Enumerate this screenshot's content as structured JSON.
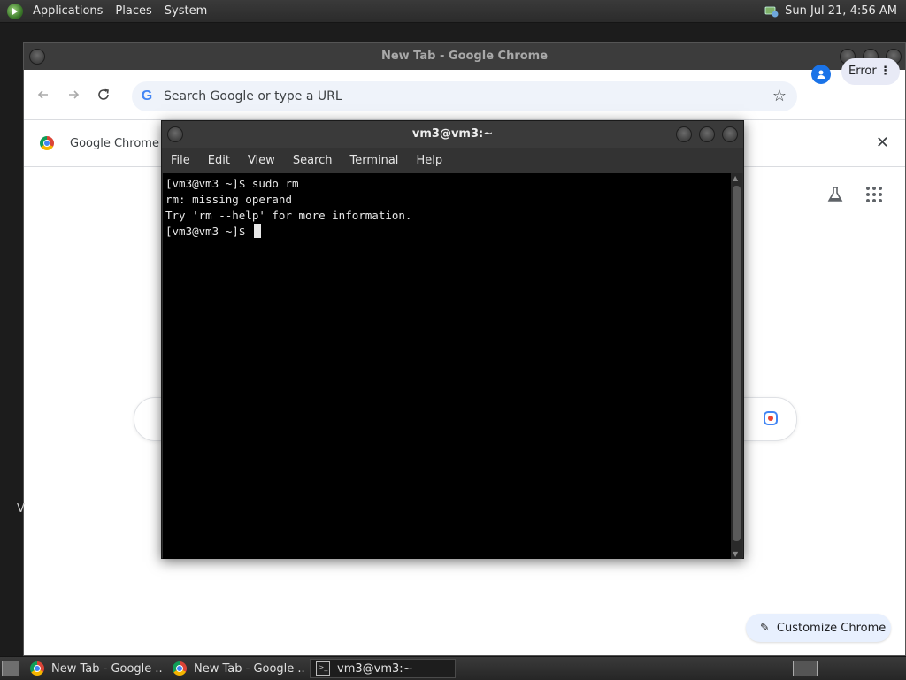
{
  "top_panel": {
    "menus": [
      "Applications",
      "Places",
      "System"
    ],
    "clock": "Sun Jul 21,  4:56 AM"
  },
  "chrome": {
    "window_title": "New Tab - Google Chrome",
    "omnibox_placeholder": "Search Google or type a URL",
    "profile_error_label": "Error",
    "infobar_text": "Google Chrome isn't",
    "customize_label": "Customize Chrome",
    "edge_letter": "V"
  },
  "terminal": {
    "title": "vm3@vm3:~",
    "menus": [
      "File",
      "Edit",
      "View",
      "Search",
      "Terminal",
      "Help"
    ],
    "lines": [
      "[vm3@vm3 ~]$ sudo rm",
      "rm: missing operand",
      "Try 'rm --help' for more information.",
      "[vm3@vm3 ~]$ "
    ]
  },
  "taskbar": {
    "tasks": [
      "New Tab - Google ...",
      "New Tab - Google ...",
      "vm3@vm3:~"
    ]
  },
  "colors": {
    "panel": "#2b2b2b",
    "terminal_bg": "#000000",
    "accent": "#1a73e8"
  }
}
